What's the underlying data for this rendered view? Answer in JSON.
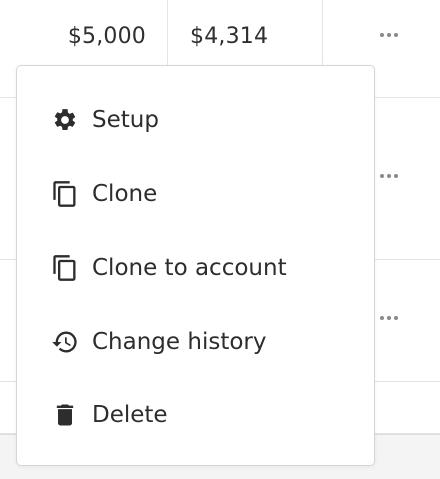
{
  "table": {
    "row1": {
      "budget": "$5,000",
      "spent": "$4,314"
    }
  },
  "context_menu": {
    "items": [
      {
        "label": "Setup",
        "icon": "gear-icon"
      },
      {
        "label": "Clone",
        "icon": "copy-icon"
      },
      {
        "label": "Clone to account",
        "icon": "copy-icon"
      },
      {
        "label": "Change history",
        "icon": "history-icon"
      },
      {
        "label": "Delete",
        "icon": "trash-icon"
      }
    ]
  },
  "colors": {
    "text": "#2d2d2d",
    "border": "#d6d6d6",
    "dots": "#8a8a8a",
    "footer": "#f4f4f4"
  }
}
